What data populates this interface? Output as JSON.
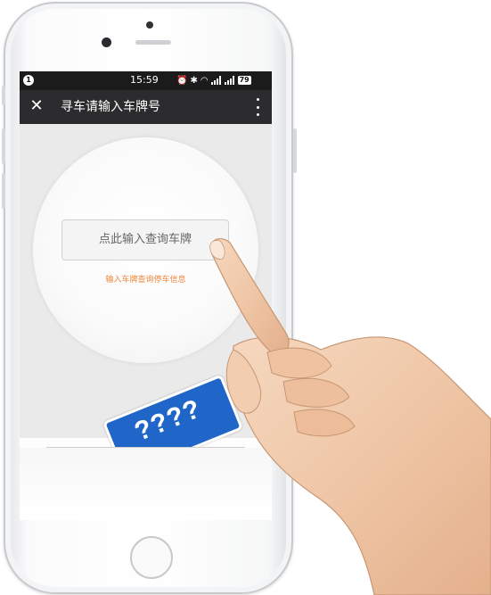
{
  "status_bar": {
    "notification_badge": "1",
    "time": "15:59",
    "battery": "79"
  },
  "header": {
    "title": "寻车请输入车牌号"
  },
  "main": {
    "input_placeholder": "点此输入查询车牌",
    "hint": "输入车牌查询停车信息",
    "plate_graphic_text": "????"
  },
  "colors": {
    "hint": "#f0863a",
    "plate": "#1f66c8",
    "title_bar": "#2c2c2e"
  }
}
